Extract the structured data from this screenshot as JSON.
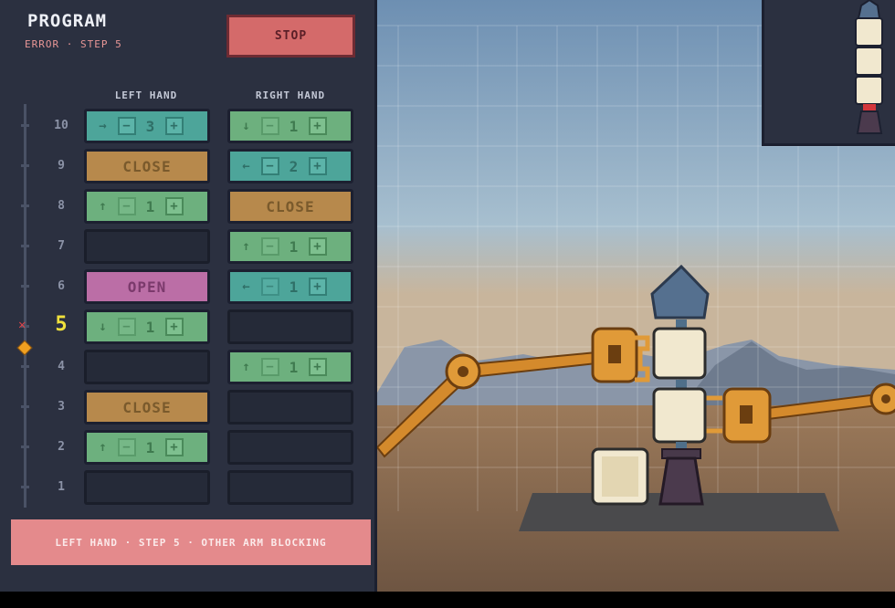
{
  "program": {
    "title": "PROGRAM",
    "status": "ERROR · STEP 5",
    "stop_label": "STOP",
    "columns": {
      "left": "LEFT HAND",
      "right": "RIGHT HAND"
    },
    "current_step": 5,
    "rows": [
      {
        "step": "10",
        "left": {
          "type": "move",
          "color": "teal",
          "dir": "right",
          "value": "3"
        },
        "right": {
          "type": "move",
          "color": "green",
          "dir": "down",
          "value": "1"
        }
      },
      {
        "step": "9",
        "left": {
          "type": "close",
          "label": "CLOSE"
        },
        "right": {
          "type": "move",
          "color": "teal",
          "dir": "left",
          "value": "2"
        }
      },
      {
        "step": "8",
        "left": {
          "type": "move",
          "color": "green",
          "dir": "up",
          "value": "1"
        },
        "right": {
          "type": "close",
          "label": "CLOSE"
        }
      },
      {
        "step": "7",
        "left": {
          "type": "empty"
        },
        "right": {
          "type": "move",
          "color": "green",
          "dir": "up",
          "value": "1"
        }
      },
      {
        "step": "6",
        "left": {
          "type": "open",
          "label": "OPEN"
        },
        "right": {
          "type": "move",
          "color": "teal",
          "dir": "left",
          "value": "1"
        }
      },
      {
        "step": "5",
        "left": {
          "type": "move",
          "color": "green",
          "dir": "down",
          "value": "1"
        },
        "right": {
          "type": "empty"
        }
      },
      {
        "step": "4",
        "left": {
          "type": "empty"
        },
        "right": {
          "type": "move",
          "color": "green",
          "dir": "up",
          "value": "1"
        }
      },
      {
        "step": "3",
        "left": {
          "type": "close",
          "label": "CLOSE"
        },
        "right": {
          "type": "empty"
        }
      },
      {
        "step": "2",
        "left": {
          "type": "move",
          "color": "green",
          "dir": "up",
          "value": "1"
        },
        "right": {
          "type": "empty"
        }
      },
      {
        "step": "1",
        "left": {
          "type": "empty"
        },
        "right": {
          "type": "empty"
        }
      }
    ],
    "error_message": "LEFT HAND · STEP 5 · OTHER ARM BLOCKING",
    "icons": {
      "error_marker": "x-icon",
      "playhead": "diamond-icon",
      "plus": "plus-icon",
      "minus": "minus-icon"
    }
  },
  "colors": {
    "panel": "#2b3040",
    "error": "#e48a8c",
    "stop": "#d46a6a",
    "current_step": "#f0e13c"
  }
}
